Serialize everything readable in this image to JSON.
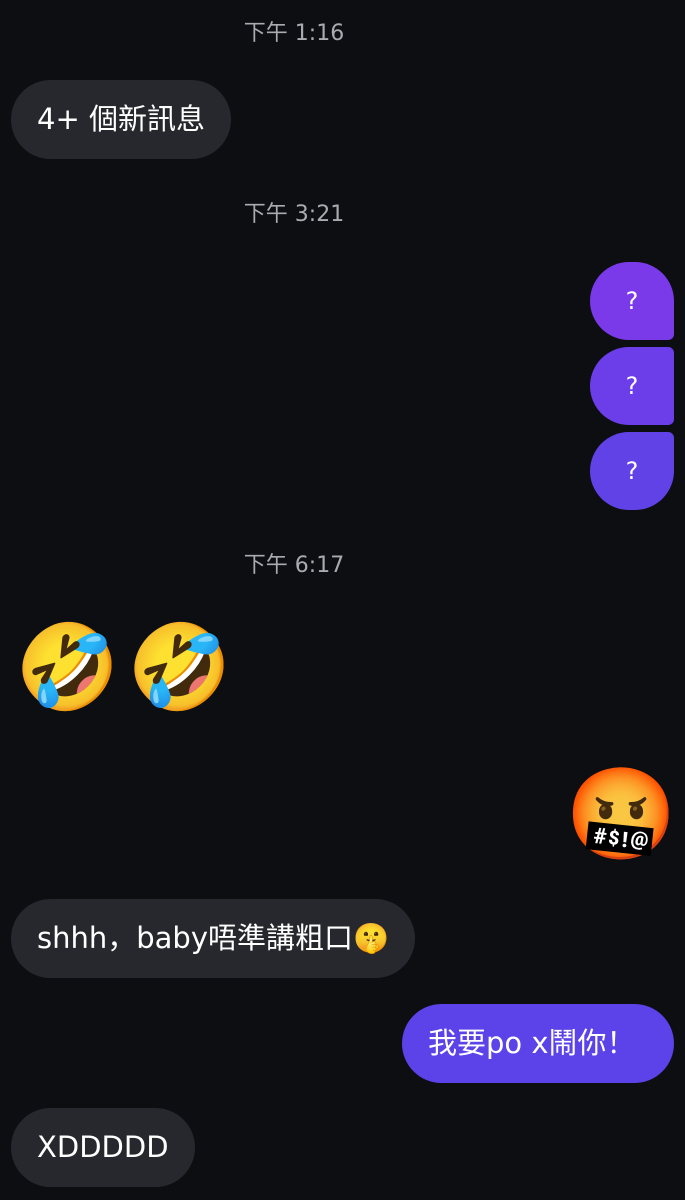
{
  "chat": {
    "timestamps": [
      "下午 1:16",
      "下午 3:21",
      "下午 6:17"
    ],
    "new_messages_label": "4+ 個新訊息",
    "outgoing_questions": [
      "?",
      "?",
      "?"
    ],
    "incoming_emoji_1": "🤣",
    "incoming_emoji_2": "🤣",
    "outgoing_emoji": "🤬",
    "incoming_text_1": "shhh，baby唔準講粗口🤫",
    "outgoing_text_1": "我要po x鬧你！",
    "incoming_text_2": "XDDDDD"
  },
  "colors": {
    "background": "#0c0e12",
    "incoming_bubble": "#26282d",
    "outgoing_bubble": "#5b43e9",
    "outgoing_gradient_top": "#7b3aea",
    "timestamp_text": "#a9abb0"
  },
  "icons": {
    "emoji_rofl": "rolling-on-the-floor-laughing",
    "emoji_cursing": "face-with-symbols-on-mouth",
    "emoji_shush": "shushing-face"
  }
}
